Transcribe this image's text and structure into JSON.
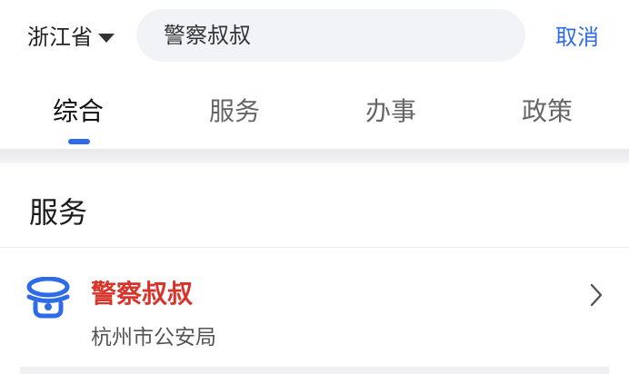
{
  "header": {
    "region_label": "浙江省",
    "search_value": "警察叔叔",
    "cancel_label": "取消"
  },
  "tabs": [
    {
      "label": "综合",
      "active": true
    },
    {
      "label": "服务",
      "active": false
    },
    {
      "label": "办事",
      "active": false
    },
    {
      "label": "政策",
      "active": false
    }
  ],
  "section": {
    "title": "服务"
  },
  "results": [
    {
      "title": "警察叔叔",
      "subtitle": "杭州市公安局",
      "icon": "police-cap-icon"
    }
  ],
  "colors": {
    "accent": "#2e6be6",
    "highlight": "#d8342b"
  }
}
